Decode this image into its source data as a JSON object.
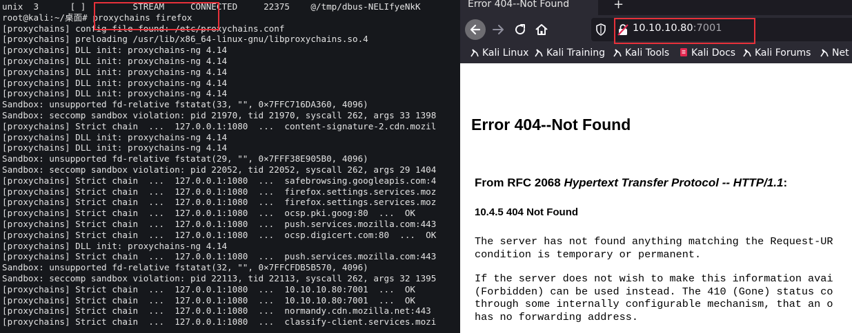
{
  "terminal": {
    "lines": [
      "unix  3      [ ]         STREAM     CONNECTED     22375    @/tmp/dbus-NELIfyeNkK",
      "root@kali:~/桌面# proxychains firefox",
      "[proxychains] config file found: /etc/proxychains.conf",
      "[proxychains] preloading /usr/lib/x86_64-linux-gnu/libproxychains.so.4",
      "[proxychains] DLL init: proxychains-ng 4.14",
      "[proxychains] DLL init: proxychains-ng 4.14",
      "[proxychains] DLL init: proxychains-ng 4.14",
      "[proxychains] DLL init: proxychains-ng 4.14",
      "[proxychains] DLL init: proxychains-ng 4.14",
      "Sandbox: unsupported fd-relative fstatat(33, \"\", 0×7FFC716DA360, 4096)",
      "Sandbox: seccomp sandbox violation: pid 21970, tid 21970, syscall 262, args 33 1398",
      "[proxychains] Strict chain  ...  127.0.0.1:1080  ...  content-signature-2.cdn.mozil",
      "[proxychains] DLL init: proxychains-ng 4.14",
      "[proxychains] DLL init: proxychains-ng 4.14",
      "Sandbox: unsupported fd-relative fstatat(29, \"\", 0×7FFF38E905B0, 4096)",
      "Sandbox: seccomp sandbox violation: pid 22052, tid 22052, syscall 262, args 29 1404",
      "[proxychains] Strict chain  ...  127.0.0.1:1080  ...  safebrowsing.googleapis.com:4",
      "[proxychains] Strict chain  ...  127.0.0.1:1080  ...  firefox.settings.services.moz",
      "[proxychains] Strict chain  ...  127.0.0.1:1080  ...  firefox.settings.services.moz",
      "[proxychains] Strict chain  ...  127.0.0.1:1080  ...  ocsp.pki.goog:80  ...  OK",
      "[proxychains] Strict chain  ...  127.0.0.1:1080  ...  push.services.mozilla.com:443",
      "[proxychains] Strict chain  ...  127.0.0.1:1080  ...  ocsp.digicert.com:80  ...  OK",
      "[proxychains] DLL init: proxychains-ng 4.14",
      "[proxychains] Strict chain  ...  127.0.0.1:1080  ...  push.services.mozilla.com:443",
      "Sandbox: unsupported fd-relative fstatat(32, \"\", 0×7FFCFDB5B570, 4096)",
      "Sandbox: seccomp sandbox violation: pid 22113, tid 22113, syscall 262, args 32 1395",
      "[proxychains] Strict chain  ...  127.0.0.1:1080  ...  10.10.10.80:7001  ...  OK",
      "[proxychains] Strict chain  ...  127.0.0.1:1080  ...  10.10.10.80:7001  ...  OK",
      "[proxychains] Strict chain  ...  127.0.0.1:1080  ...  normandy.cdn.mozilla.net:443",
      "[proxychains] Strict chain  ...  127.0.0.1:1080  ...  classify-client.services.mozi"
    ]
  },
  "browser": {
    "tab_title": "Error 404--Not Found",
    "new_tab": "+",
    "url_host": "10.10.10.80",
    "url_port": ":7001",
    "bookmarks": [
      {
        "label": "Kali Linux",
        "icon": "kali-dragon-icon"
      },
      {
        "label": "Kali Training",
        "icon": "kali-dragon-icon"
      },
      {
        "label": "Kali Tools",
        "icon": "kali-dragon-icon"
      },
      {
        "label": "Kali Docs",
        "icon": "kali-docs-icon"
      },
      {
        "label": "Kali Forums",
        "icon": "kali-dragon-icon"
      },
      {
        "label": "Net",
        "icon": "kali-dragon-icon"
      }
    ],
    "page": {
      "heading": "Error 404--Not Found",
      "rfc_prefix": "From RFC 2068 ",
      "rfc_title": "Hypertext Transfer Protocol -- HTTP/1.1",
      "rfc_suffix": ":",
      "section": "10.4.5 404 Not Found",
      "para1": [
        "The server has not found anything matching the Request-UR",
        "condition is temporary or permanent."
      ],
      "para2": [
        "If the server does not wish to make this information avai",
        "(Forbidden) can be used instead. The 410 (Gone) status co",
        "through some internally configurable mechanism, that an o",
        "has no forwarding address."
      ]
    }
  },
  "colors": {
    "terminal_bg": "#16181c",
    "highlight": "#e8313a",
    "browser_chrome": "#2b2a33"
  }
}
